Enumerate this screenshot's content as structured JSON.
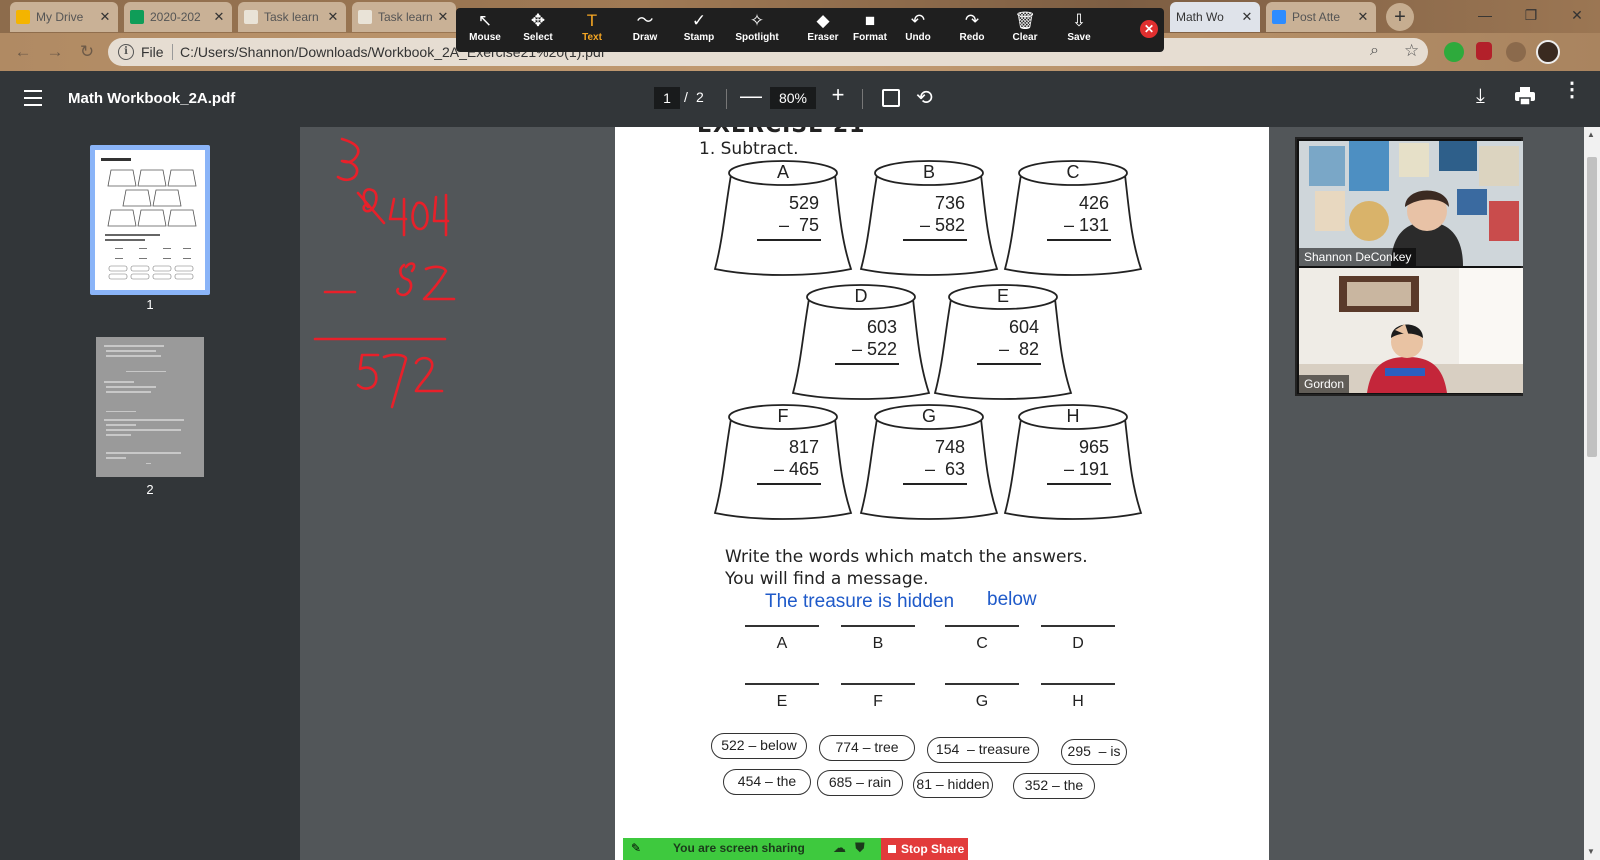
{
  "browser": {
    "tabs": [
      {
        "label": "My Drive",
        "fav_color": "#f4b400"
      },
      {
        "label": "2020-202",
        "fav_color": "#0f9d58"
      },
      {
        "label": "Task learn",
        "fav_color": "#e9e3d7"
      },
      {
        "label": "Task learn",
        "fav_color": "#e9e3d7"
      },
      {
        "label": "Math Wo",
        "fav_color": "#c9b196"
      },
      {
        "label": "Post Atte",
        "fav_color": "#2d8cff"
      }
    ],
    "close_glyph": "✕",
    "new_tab": "+",
    "address": {
      "scheme": "File",
      "url": "C:/Users/Shannon/Downloads/Workbook_2A_Exercise21%20(1).pdf"
    }
  },
  "zoom_toolbar": {
    "tools": [
      {
        "label": "Mouse",
        "icon": "↖"
      },
      {
        "label": "Select",
        "icon": "✥"
      },
      {
        "label": "Text",
        "icon": "T"
      },
      {
        "label": "Draw",
        "icon": "〜"
      },
      {
        "label": "Stamp",
        "icon": "✓"
      },
      {
        "label": "Spotlight",
        "icon": "✧"
      },
      {
        "label": "Eraser",
        "icon": "◆"
      },
      {
        "label": "Format",
        "icon": "■"
      },
      {
        "label": "Undo",
        "icon": "↶"
      },
      {
        "label": "Redo",
        "icon": "↷"
      },
      {
        "label": "Clear",
        "icon": "🗑"
      },
      {
        "label": "Save",
        "icon": "⇩"
      }
    ],
    "selected": "Text",
    "close": "✕"
  },
  "pdf_viewer": {
    "title": "Math Workbook_2A.pdf",
    "page_current": "1",
    "page_sep": "/",
    "page_total": "2",
    "zoom": "80%",
    "zoom_out": "—",
    "zoom_in": "+",
    "thumbnails": [
      "1",
      "2"
    ]
  },
  "worksheet": {
    "heading": "EXERCISE 21",
    "instruction": "1.  Subtract.",
    "stumps": [
      {
        "letter": "A",
        "top": "529",
        "bottom": "–  75"
      },
      {
        "letter": "B",
        "top": "736",
        "bottom": "– 582"
      },
      {
        "letter": "C",
        "top": "426",
        "bottom": "– 131"
      },
      {
        "letter": "D",
        "top": "603",
        "bottom": "– 522"
      },
      {
        "letter": "E",
        "top": "604",
        "bottom": "–  82"
      },
      {
        "letter": "F",
        "top": "817",
        "bottom": "– 465"
      },
      {
        "letter": "G",
        "top": "748",
        "bottom": "–  63"
      },
      {
        "letter": "H",
        "top": "965",
        "bottom": "– 191"
      }
    ],
    "message_line1": "Write the words which match the answers.",
    "message_line2": "You will find a message.",
    "typed_answer_1": "The treasure is hidden",
    "typed_answer_2": "below",
    "blank_labels": [
      "A",
      "B",
      "C",
      "D",
      "E",
      "F",
      "G",
      "H"
    ],
    "word_bank": [
      "522 – below",
      "774 – tree",
      "154  – treasure",
      "295  – is",
      "454 – the",
      "685 – rain",
      "81 – hidden",
      "352 – the"
    ]
  },
  "annotation": {
    "color": "#e8202a",
    "strings": [
      "604",
      "82",
      "5",
      "522"
    ]
  },
  "video_panel": {
    "participants": [
      "Shannon DeConkey",
      "Gordon"
    ]
  },
  "share_bar": {
    "status": "You are screen sharing",
    "stop": "Stop Share",
    "green": "#3ec93e",
    "red": "#e23b3b"
  }
}
